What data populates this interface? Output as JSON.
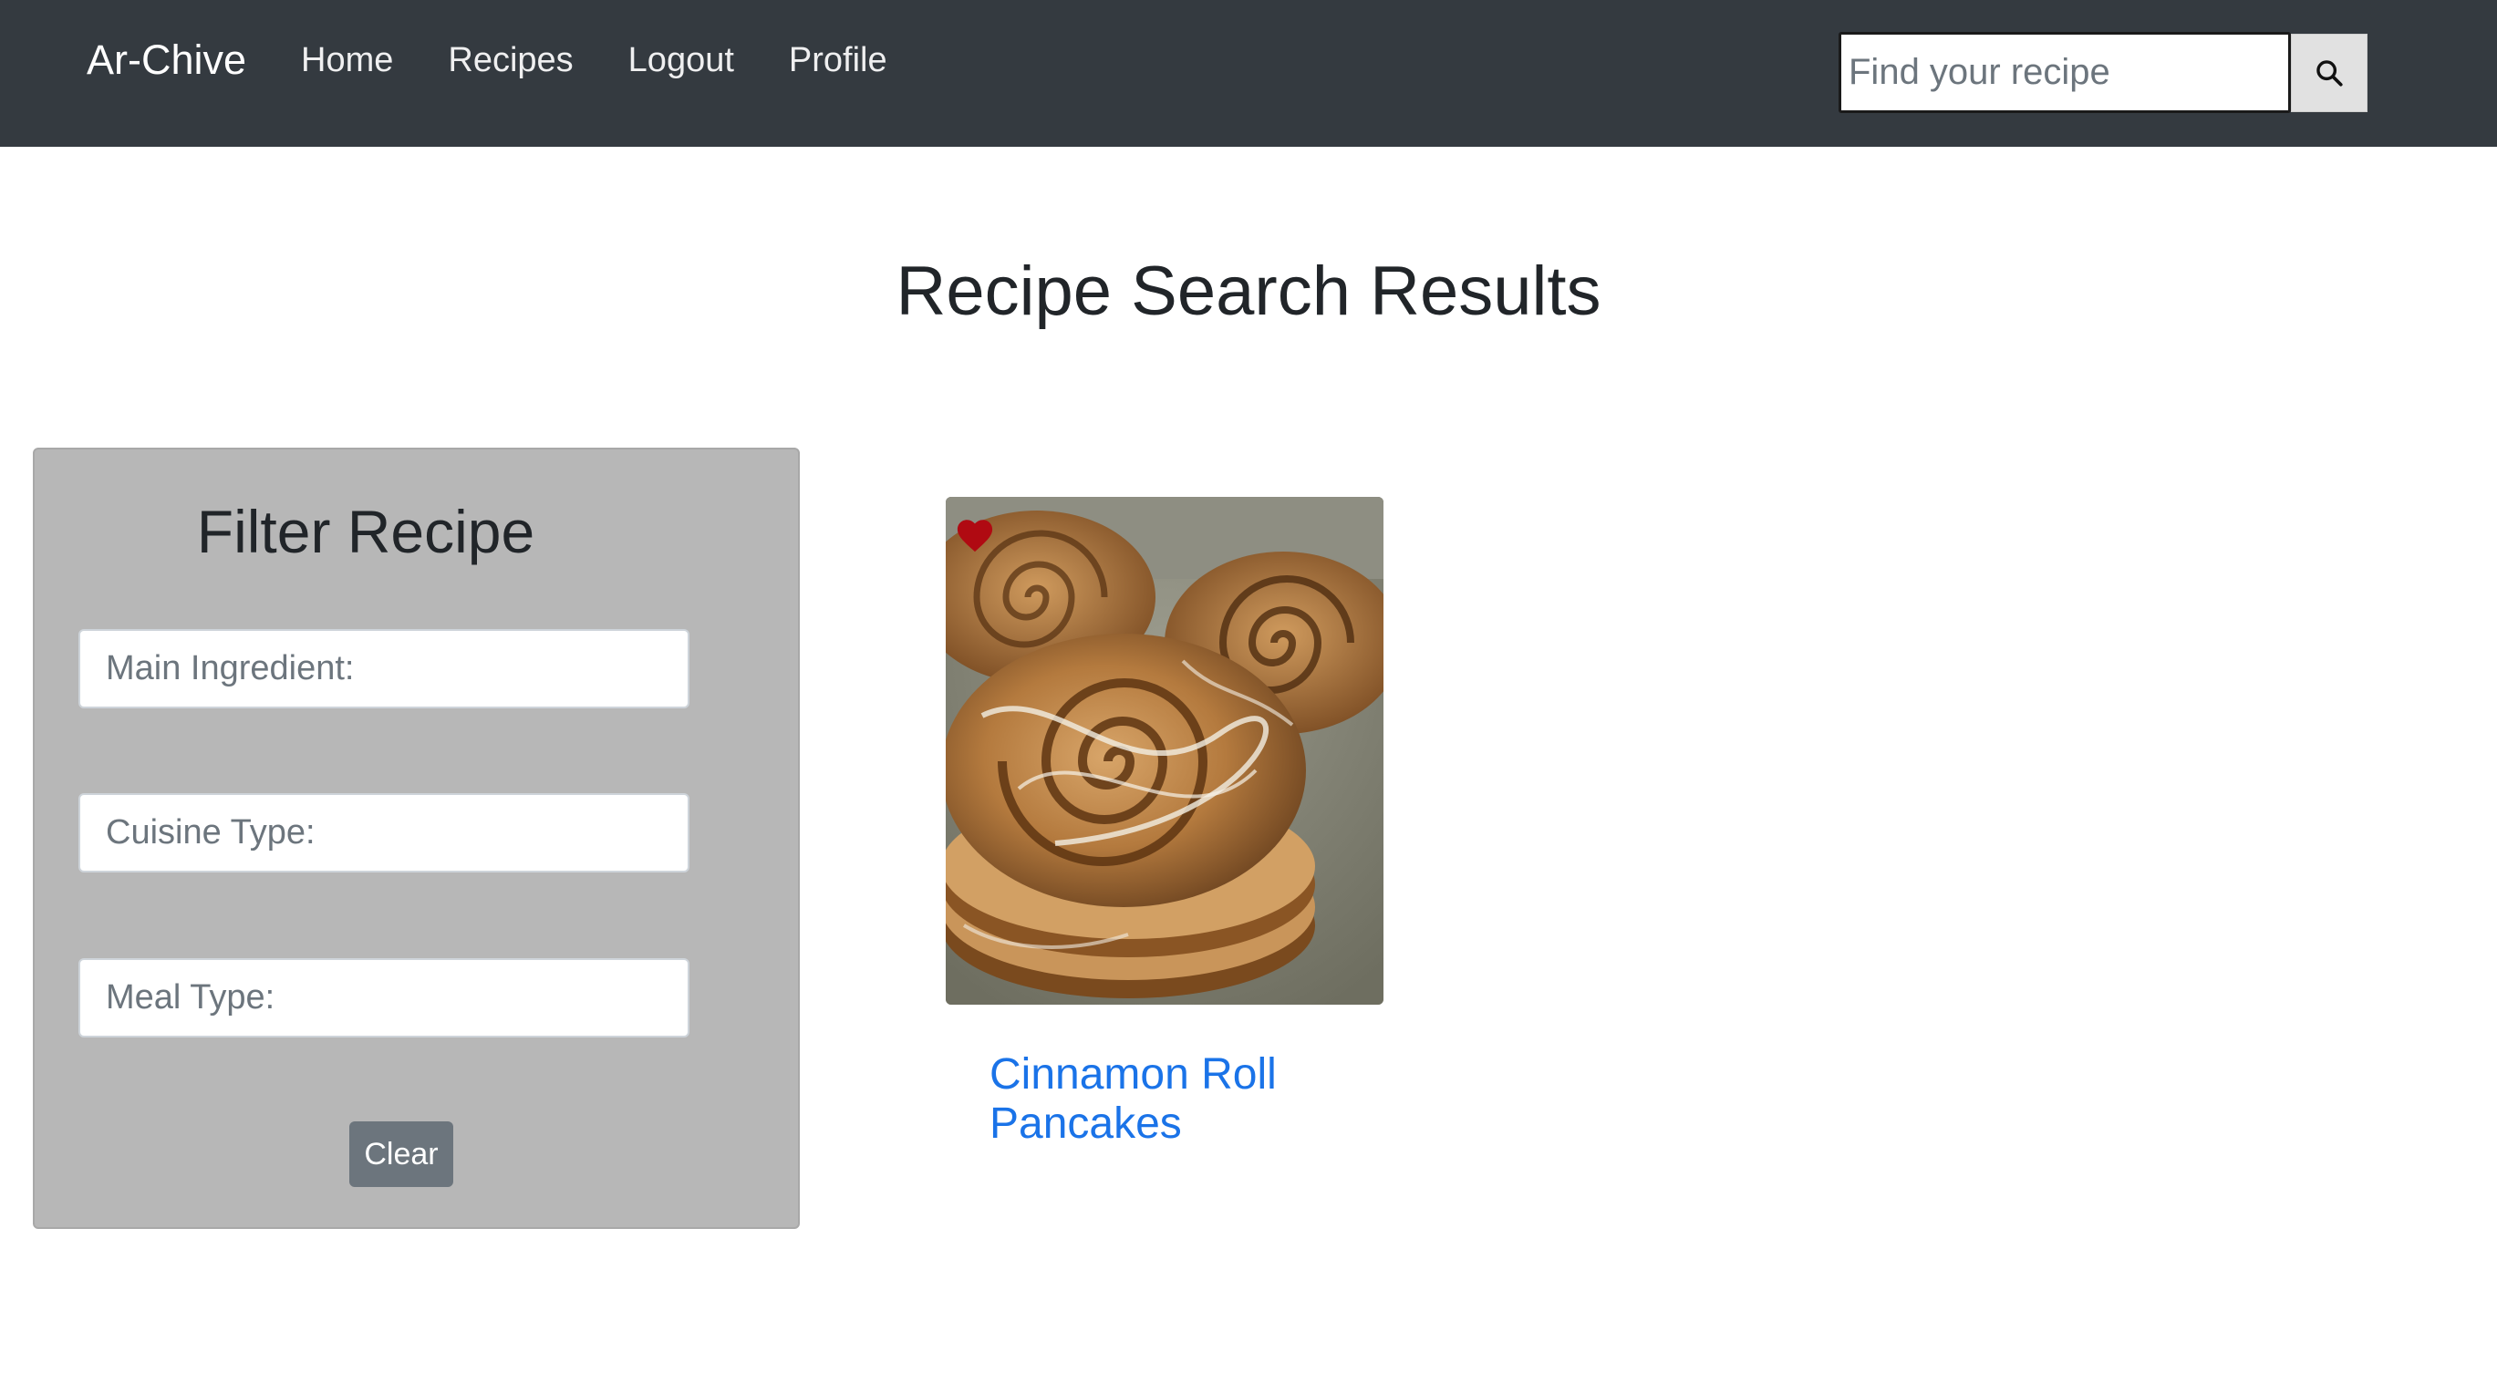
{
  "navbar": {
    "brand": "Ar-Chive",
    "links": [
      {
        "label": "Home"
      },
      {
        "label": "Recipes"
      },
      {
        "label": "Logout"
      },
      {
        "label": "Profile"
      }
    ],
    "search": {
      "placeholder": "Find your recipe",
      "icon": "search-icon"
    }
  },
  "main": {
    "title": "Recipe Search Results"
  },
  "filter": {
    "title": "Filter Recipe",
    "fields": [
      {
        "placeholder": "Main Ingredient:"
      },
      {
        "placeholder": "Cuisine Type:"
      },
      {
        "placeholder": "Meal Type:"
      }
    ],
    "clear_label": "Clear"
  },
  "results": [
    {
      "title": "Cinnamon Roll Pancakes",
      "favorite": true,
      "favorite_color": "#b00a12"
    }
  ],
  "colors": {
    "navbar_bg": "#343a40",
    "panel_bg": "#b7b7b7",
    "link_blue": "#1a73e8",
    "clear_button": "#6c757d"
  }
}
